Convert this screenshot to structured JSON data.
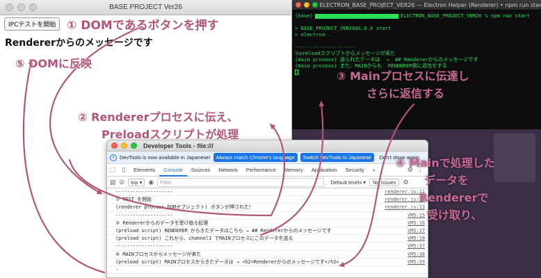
{
  "app": {
    "title": "BASE PROJECT Ver26",
    "ipc_button": "IPCテストを開始",
    "renderer_message": "Rendererからのメッセージです"
  },
  "terminal": {
    "title": "ELECTRON_BASE_PROJECT_VER26 — Electron Helper (Renderer) • npm run start",
    "prompt_prefix": "(base)",
    "prompt_suffix": "ELECTRON_BASE_PROJECT_VER26 % npm run start",
    "lines": [
      "",
      "> BASE_PROJECT_VER26@1.0.0 start",
      "> electron .",
      "",
      "--------------------",
      "③preloadスクリプトからメッセージが来た",
      "(main process) 送られたデータは  →  ## Rendererからのメッセージです",
      "(main process) また、MAINからも  RENDERER側に返信をする"
    ]
  },
  "devtools": {
    "title": "Developer Tools - file:///",
    "banner_text": "DevTools is now available in Japanese!",
    "banner_btn_match": "Always match Chrome's language",
    "banner_btn_switch": "Switch DevTools to Japanese",
    "banner_btn_dont": "Don't show again",
    "tabs": [
      "Elements",
      "Console",
      "Sources",
      "Network",
      "Performance",
      "Memory",
      "Application",
      "Security",
      "»"
    ],
    "toolbar": {
      "context": "top ▾",
      "filter_placeholder": "Filter",
      "levels": "Default levels ▾",
      "issues": "No Issues"
    },
    "console_rows": [
      {
        "msg": "--------------------",
        "src": "renderer.js:11"
      },
      {
        "msg": "① TEST を開始",
        "src": "renderer.js:12"
      },
      {
        "msg": "(renderer process DOMオブジェクト) ボタンが押された！",
        "src": "renderer.js:13"
      },
      {
        "msg": "--------------------",
        "src": "VM5:15"
      },
      {
        "msg": "② Rendererからのデータを受け取る処理",
        "src": "VM5:16"
      },
      {
        "msg": "(preload script) RENDERER からきたデータはこちら  →  ## Rendererからのメッセージです",
        "src": "VM5:17"
      },
      {
        "msg": "(preload script) これから、channel1 でMAINプロセスにこのデータを送る",
        "src": "VM5:18"
      },
      {
        "msg": "--------------------",
        "src": "VM5:37"
      },
      {
        "msg": "④ MAINプロセスからメッセージが来た",
        "src": "VM5:38"
      },
      {
        "msg": "(preload script) MAINプロセスからきたデータは  →  <h2>Rendererからのメッセージです</h2>",
        "src": "VM5:39"
      },
      {
        "msg": "›",
        "src": ""
      }
    ]
  },
  "annotations": {
    "a1": "① DOMであるボタンを押す",
    "a5": "⑤ DOMに反映",
    "a2_line1": "② Rendererプロセスに伝え、",
    "a2_line2": "Preloadスクリプトが処理",
    "a3_line1": "③ Mainプロセスに伝達し",
    "a3_line2": "さらに返信する",
    "a4_line1": "④ Mainで処理した",
    "a4_line2": "データを",
    "a4_line3": "Rendererで",
    "a4_line4": "受け取り、"
  },
  "colors": {
    "annotation": "#b3557b",
    "terminal_text": "#28e05a",
    "devtools_accent": "#1a73e8"
  }
}
